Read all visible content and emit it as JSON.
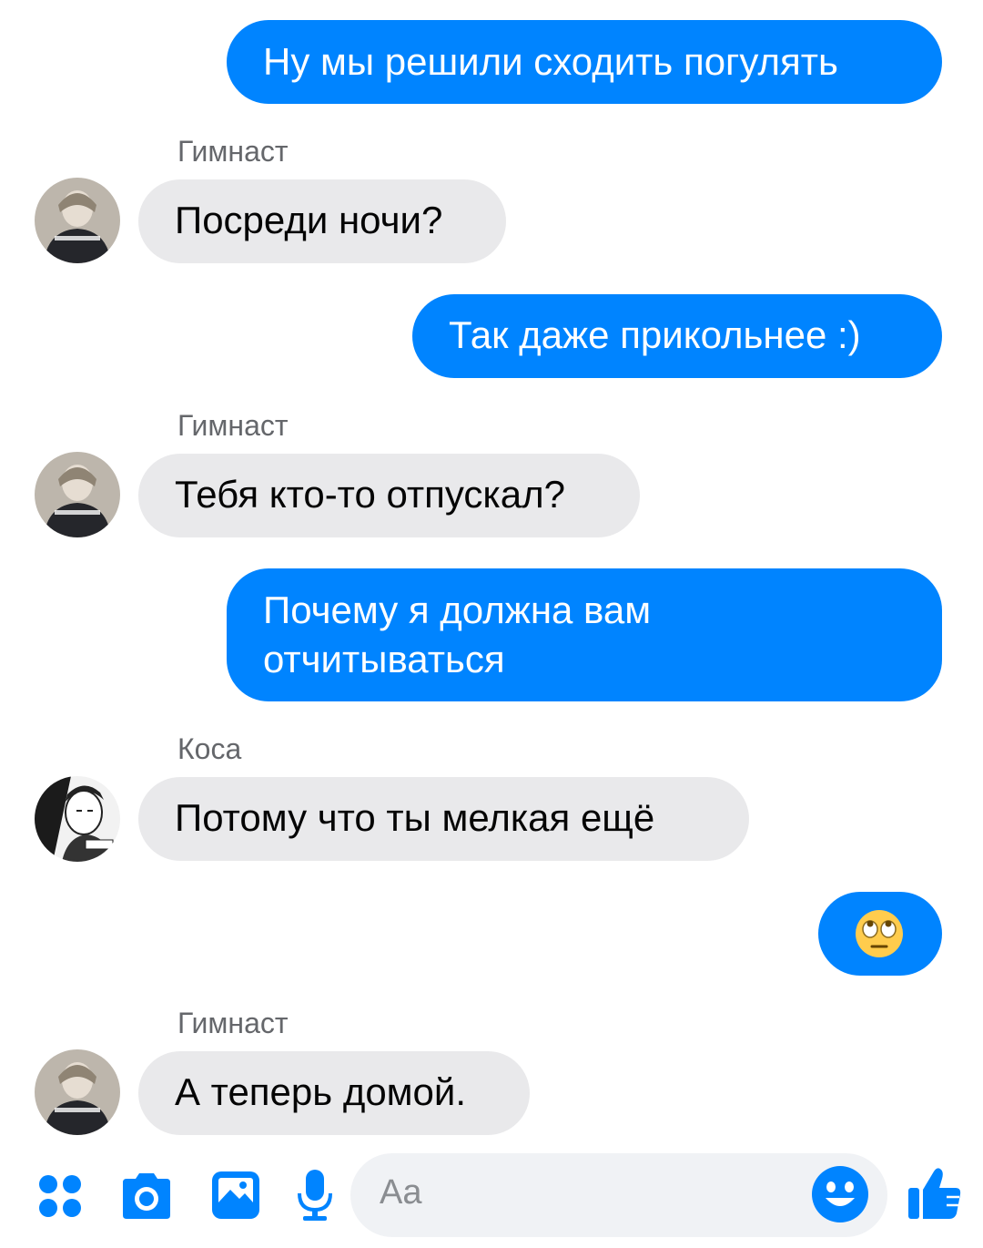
{
  "messages": [
    {
      "text": "Ну мы решили сходить погулять"
    },
    {
      "sender": "Гимнаст",
      "text": "Посреди ночи?"
    },
    {
      "text": "Так даже прикольнее :)"
    },
    {
      "sender": "Гимнаст",
      "text": "Тебя кто-то отпускал?"
    },
    {
      "line1": "Почему я должна вам",
      "line2": "отчитываться"
    },
    {
      "sender": "Коса",
      "text": "Потому что ты мелкая ещё"
    },
    {
      "text": "🙄"
    },
    {
      "sender": "Гимнаст",
      "text": "А теперь домой."
    }
  ],
  "composer": {
    "placeholder": "Aa",
    "icons": [
      "apps-icon",
      "camera-icon",
      "gallery-icon",
      "microphone-icon",
      "emoji-icon",
      "thumbs-up-icon"
    ]
  },
  "colors": {
    "outgoing_bubble": "#0084ff",
    "incoming_bubble": "#e9e9eb",
    "accent": "#0084ff"
  }
}
